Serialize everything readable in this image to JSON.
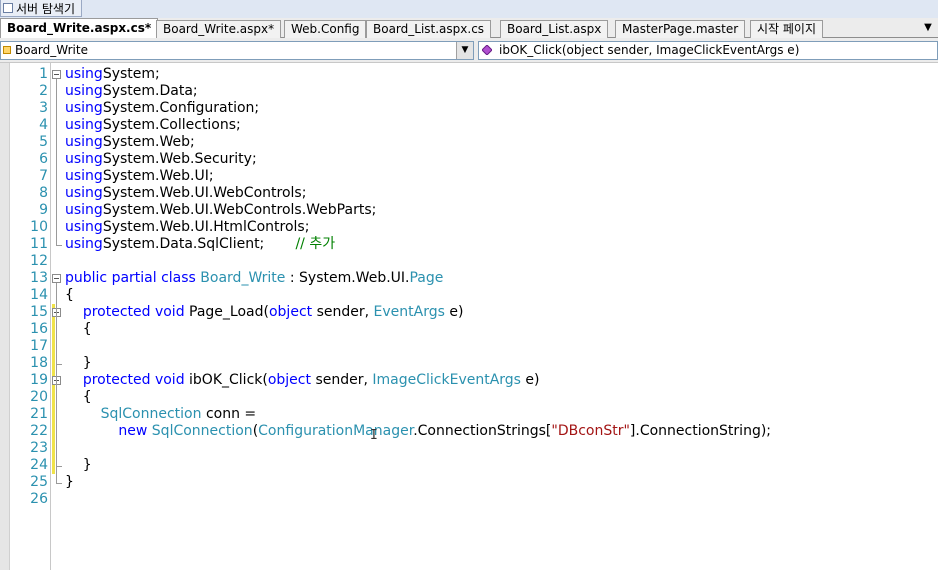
{
  "server_tab": {
    "label": "서버 탐색기"
  },
  "tabs": [
    {
      "label": "Board_Write.aspx.cs*",
      "active": true
    },
    {
      "label": "Board_Write.aspx*",
      "active": false
    },
    {
      "label": "Web.Config",
      "active": false
    },
    {
      "label": "Board_List.aspx.cs",
      "active": false
    },
    {
      "label": "Board_List.aspx",
      "active": false
    },
    {
      "label": "MasterPage.master",
      "active": false
    },
    {
      "label": "시작 페이지",
      "active": false
    }
  ],
  "tab_menu": {
    "label": "▼"
  },
  "class_dropdown": {
    "value": "Board_Write",
    "arrow": "▼"
  },
  "member_dropdown": {
    "value": "ibOK_Click(object sender, ImageClickEventArgs e)"
  },
  "cursor": {
    "glyph": "I"
  },
  "code_lines": [
    {
      "num": "1",
      "tokens": [
        [
          "kw",
          "using"
        ],
        [
          "",
          "System;"
        ]
      ]
    },
    {
      "num": "2",
      "tokens": [
        [
          "kw",
          "using"
        ],
        [
          "",
          "System.Data;"
        ]
      ]
    },
    {
      "num": "3",
      "tokens": [
        [
          "kw",
          "using"
        ],
        [
          "",
          "System.Configuration;"
        ]
      ]
    },
    {
      "num": "4",
      "tokens": [
        [
          "kw",
          "using"
        ],
        [
          "",
          "System.Collections;"
        ]
      ]
    },
    {
      "num": "5",
      "tokens": [
        [
          "kw",
          "using"
        ],
        [
          "",
          "System.Web;"
        ]
      ]
    },
    {
      "num": "6",
      "tokens": [
        [
          "kw",
          "using"
        ],
        [
          "",
          "System.Web.Security;"
        ]
      ]
    },
    {
      "num": "7",
      "tokens": [
        [
          "kw",
          "using"
        ],
        [
          "",
          "System.Web.UI;"
        ]
      ]
    },
    {
      "num": "8",
      "tokens": [
        [
          "kw",
          "using"
        ],
        [
          "",
          "System.Web.UI.WebControls;"
        ]
      ]
    },
    {
      "num": "9",
      "tokens": [
        [
          "kw",
          "using"
        ],
        [
          "",
          "System.Web.UI.WebControls.WebParts;"
        ]
      ]
    },
    {
      "num": "10",
      "tokens": [
        [
          "kw",
          "using"
        ],
        [
          "",
          "System.Web.UI.HtmlControls;"
        ]
      ]
    },
    {
      "num": "11",
      "tokens": [
        [
          "kw",
          "using"
        ],
        [
          "",
          "System.Data.SqlClient;       "
        ],
        [
          "cm",
          "// 추가"
        ]
      ]
    },
    {
      "num": "12",
      "tokens": []
    },
    {
      "num": "13",
      "tokens": [
        [
          "kw",
          "public partial class "
        ],
        [
          "ty",
          "Board_Write"
        ],
        [
          "",
          " : System.Web.UI."
        ],
        [
          "ty",
          "Page"
        ]
      ]
    },
    {
      "num": "14",
      "tokens": [
        [
          "",
          "{"
        ]
      ]
    },
    {
      "num": "15",
      "tokens": [
        [
          "",
          "    "
        ],
        [
          "kw",
          "protected void "
        ],
        [
          "",
          "Page_Load("
        ],
        [
          "kw",
          "object"
        ],
        [
          "",
          " sender, "
        ],
        [
          "ty",
          "EventArgs"
        ],
        [
          "",
          " e)"
        ]
      ]
    },
    {
      "num": "16",
      "tokens": [
        [
          "",
          "    {"
        ]
      ]
    },
    {
      "num": "17",
      "tokens": []
    },
    {
      "num": "18",
      "tokens": [
        [
          "",
          "    }"
        ]
      ]
    },
    {
      "num": "19",
      "tokens": [
        [
          "",
          "    "
        ],
        [
          "kw",
          "protected void "
        ],
        [
          "",
          "ibOK_Click("
        ],
        [
          "kw",
          "object"
        ],
        [
          "",
          " sender, "
        ],
        [
          "ty",
          "ImageClickEventArgs"
        ],
        [
          "",
          " e)"
        ]
      ]
    },
    {
      "num": "20",
      "tokens": [
        [
          "",
          "    {"
        ]
      ]
    },
    {
      "num": "21",
      "tokens": [
        [
          "",
          "        "
        ],
        [
          "ty",
          "SqlConnection"
        ],
        [
          "",
          " conn ="
        ]
      ]
    },
    {
      "num": "22",
      "tokens": [
        [
          "",
          "            "
        ],
        [
          "kw",
          "new "
        ],
        [
          "ty",
          "SqlConnection"
        ],
        [
          "",
          "("
        ],
        [
          "ty",
          "ConfigurationManager"
        ],
        [
          "",
          ".ConnectionStrings["
        ],
        [
          "st",
          "\"DBconStr\""
        ],
        [
          "",
          "].ConnectionString);"
        ]
      ]
    },
    {
      "num": "23",
      "tokens": []
    },
    {
      "num": "24",
      "tokens": [
        [
          "",
          "    }"
        ]
      ]
    },
    {
      "num": "25",
      "tokens": [
        [
          "",
          "}"
        ]
      ]
    },
    {
      "num": "26",
      "tokens": []
    }
  ]
}
